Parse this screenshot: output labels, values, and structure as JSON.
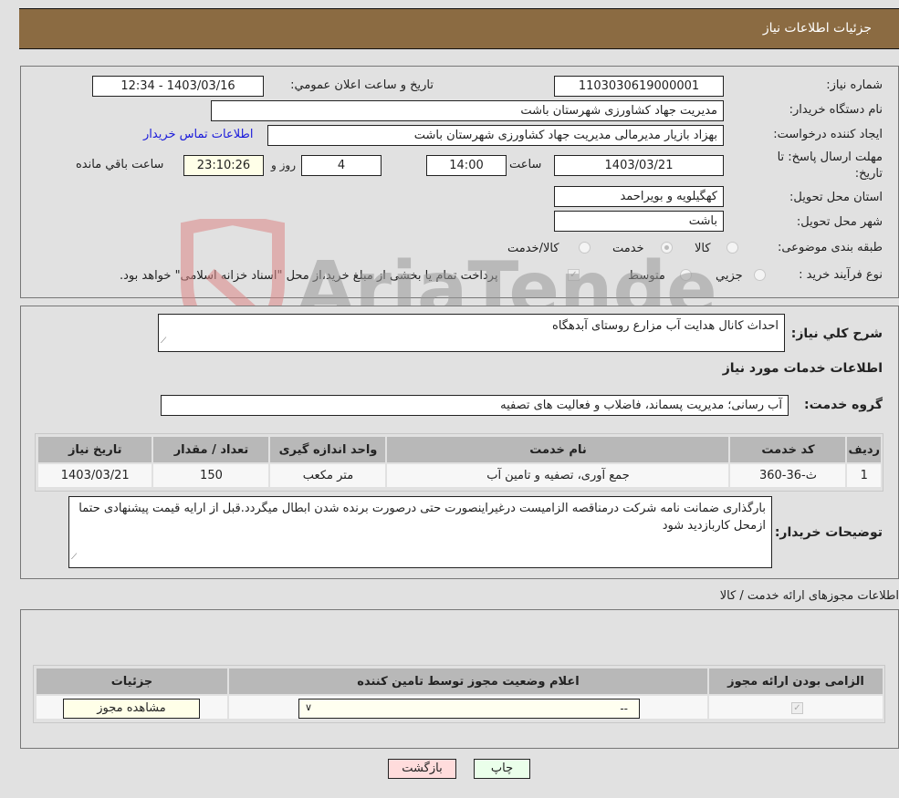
{
  "header": {
    "title": "جزئیات اطلاعات نیاز"
  },
  "details": {
    "need_number_label": "شماره نیاز:",
    "need_number": "1103030619000001",
    "announce_label": "تاریخ و ساعت اعلان عمومي:",
    "announce_value": "1403/03/16 - 12:34",
    "buyer_org_label": "نام دستگاه خریدار:",
    "buyer_org": "مدیریت جهاد کشاورزی شهرستان باشت",
    "creator_label": "ایجاد کننده درخواست:",
    "creator": "بهزاد بازیار مدیرمالی مدیریت جهاد کشاورزی شهرستان باشت",
    "contact_link": "اطلاعات تماس خریدار",
    "deadline_label_1": "مهلت ارسال پاسخ: تا",
    "deadline_label_2": "تاریخ:",
    "deadline_date": "1403/03/21",
    "time_label": "ساعت",
    "deadline_time": "14:00",
    "days_value": "4",
    "days_label": "روز و",
    "remaining_time": "23:10:26",
    "remaining_label": "ساعت باقي مانده",
    "province_label": "استان محل تحویل:",
    "province": "کهگیلویه و بویراحمد",
    "city_label": "شهر محل تحویل:",
    "city": "باشت",
    "category_label": "طبقه بندی موضوعی:",
    "category_options": [
      "کالا",
      "خدمت",
      "کالا/خدمت"
    ],
    "category_selected": "خدمت",
    "process_label": "نوع فرآیند خرید :",
    "process_options": [
      "جزيي",
      "متوسط"
    ],
    "treasury_note": "پرداخت تمام یا بخشی از مبلغ خرید،از محل \"اسناد خزانه اسلامی\" خواهد بود."
  },
  "description": {
    "label": "شرح کلي نیاز:",
    "value": "احداث کانال هدایت آب مزارع روستای آبدهگاه"
  },
  "services": {
    "section_title": "اطلاعات خدمات مورد نیاز",
    "group_label": "گروه خدمت:",
    "group_value": "آب رسانی؛ مدیریت پسماند، فاضلاب و فعالیت های تصفیه",
    "columns": [
      "ردیف",
      "کد خدمت",
      "نام خدمت",
      "واحد اندازه گیری",
      "تعداد / مقدار",
      "تاریخ نیاز"
    ],
    "rows": [
      [
        "1",
        "ث-36-360",
        "جمع آوری، تصفیه و تامین آب",
        "متر مکعب",
        "150",
        "1403/03/21"
      ]
    ]
  },
  "buyer_notes": {
    "label": "توضیحات خریدار:",
    "value": "بارگذاری ضمانت نامه شرکت درمناقصه الزامیست درغیراینصورت حتی درصورت برنده شدن ابطال میگردد.قبل از ارایه قیمت پیشنهادی حتما ازمحل کاربازدید شود"
  },
  "permits": {
    "section_title": "اطلاعات مجوزهای ارائه خدمت / کالا",
    "columns": [
      "الزامی بودن ارائه مجوز",
      "اعلام وضعیت مجوز توسط تامین کننده",
      "جزئیات"
    ],
    "row": {
      "required_checked": true,
      "status_value": "--",
      "details_button": "مشاهده مجوز"
    }
  },
  "footer": {
    "print_button": "چاپ",
    "back_button": "بازگشت"
  },
  "watermark": {
    "text": "AriaTender.neT"
  }
}
